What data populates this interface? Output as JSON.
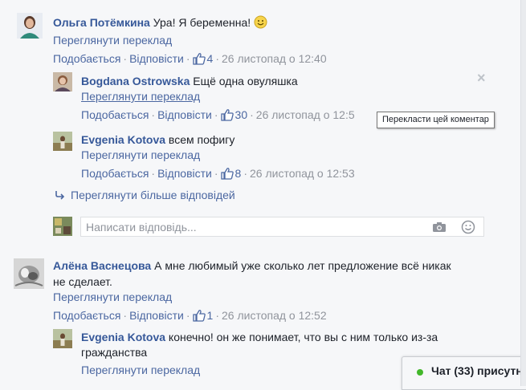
{
  "labels": {
    "see_translation": "Переглянути переклад",
    "like": "Подобається",
    "reply": "Відповісти",
    "more_replies": "Переглянути більше відповідей",
    "reply_placeholder": "Написати відповідь...",
    "translate_tooltip": "Перекласти цей коментар"
  },
  "comments": [
    {
      "author": "Ольга Потёмкина",
      "text": "Ура! Я беременна!",
      "likes": "4",
      "time": "26 листопад о 12:40",
      "replies": [
        {
          "author": "Bogdana Ostrowska",
          "text": "Ещё одна овуляшка",
          "likes": "30",
          "time": "26 листопад о 12:5"
        },
        {
          "author": "Evgenia Kotova",
          "text": "всем пофигу",
          "likes": "8",
          "time": "26 листопад о 12:53"
        }
      ]
    },
    {
      "author": "Алёна Васнецова",
      "text_line1": "А мне любимый уже сколько лет предложение всё никак",
      "text_line2": "не сделает.",
      "likes": "1",
      "time": "26 листопад о 12:52",
      "replies": [
        {
          "author": "Evgenia Kotova",
          "text_line1": "конечно! он же понимает, что вы с ним только из-за",
          "text_line2": "гражданства"
        }
      ]
    }
  ],
  "chat": {
    "label": "Чат (33) присутн"
  },
  "colors": {
    "link": "#4b67a1",
    "name": "#365899",
    "meta": "#90949c",
    "online": "#42b72a"
  }
}
